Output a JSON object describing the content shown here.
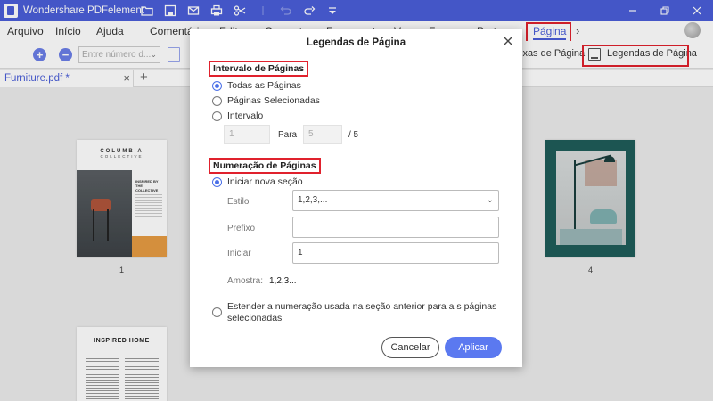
{
  "app": {
    "title": "Wondershare PDFelement"
  },
  "menubar": {
    "items": [
      {
        "label": "Arquivo"
      },
      {
        "label": "Início"
      },
      {
        "label": "Ajuda"
      },
      {
        "label": "Comentário"
      },
      {
        "label": "Editar"
      },
      {
        "label": "Converter"
      },
      {
        "label": "Ferramenta"
      },
      {
        "label": "Ver"
      },
      {
        "label": "Forma"
      },
      {
        "label": "Proteger"
      },
      {
        "label": "Página"
      }
    ],
    "active_index": 10
  },
  "toolbar": {
    "page_input_placeholder": "Entre número d...",
    "caixas_label": "ixas de Página",
    "legendas_label": "Legendas de Página"
  },
  "tabs": {
    "doc_tab": "Furniture.pdf *",
    "add": "+"
  },
  "thumbnails": [
    {
      "page": "1",
      "heading": "COLUMBIA",
      "subheading": "COLLECTIVE",
      "tagline": "INSPIRED BY THE COLLECTIVE"
    },
    {
      "page": "4"
    },
    {
      "heading": "INSPIRED HOME"
    }
  ],
  "dialog": {
    "title": "Legendas de Página",
    "range": {
      "section_title": "Intervalo de Páginas",
      "options": [
        "Todas as Páginas",
        "Páginas Selecionadas",
        "Intervalo"
      ],
      "selected": 0,
      "from": "1",
      "to_label": "Para",
      "to": "5",
      "total": "/ 5"
    },
    "numbering": {
      "section_title": "Numeração de Páginas",
      "new_section_label": "Iniciar nova seção",
      "style_label": "Estilo",
      "style_value": "1,2,3,...",
      "prefix_label": "Prefixo",
      "prefix_value": "",
      "start_label": "Iniciar",
      "start_value": "1",
      "sample_label": "Amostra:",
      "sample_value": "1,2,3...",
      "extend_label": "Estender a numeração usada na seção anterior para a s páginas selecionadas"
    },
    "buttons": {
      "cancel": "Cancelar",
      "apply": "Aplicar"
    }
  },
  "colors": {
    "accent": "#4a5ed8",
    "highlight": "#e0212d",
    "apply": "#5b79f0"
  }
}
